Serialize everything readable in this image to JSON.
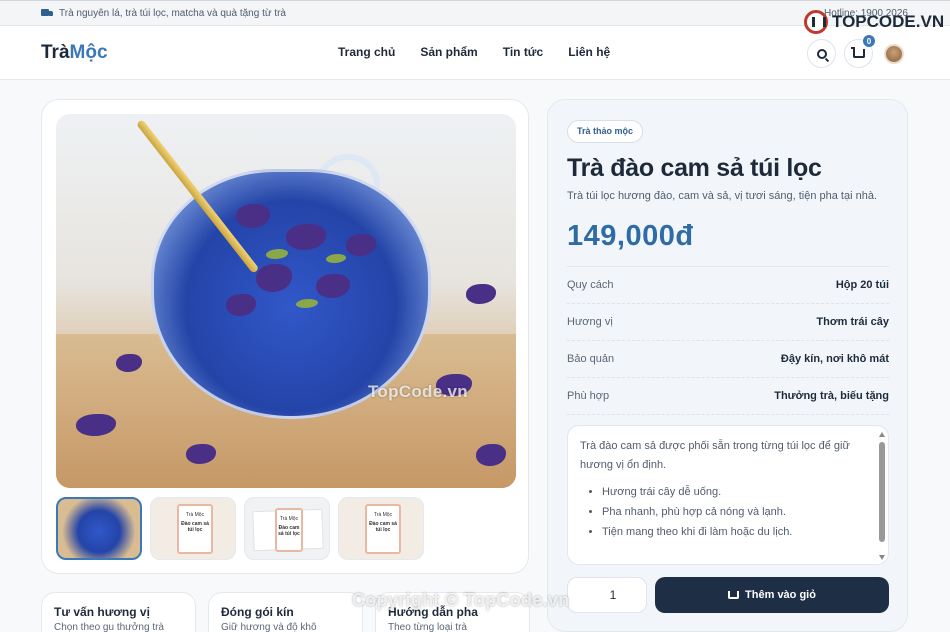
{
  "topbar": {
    "announcement": "Trà nguyên lá, trà túi lọc, matcha và quà tặng từ trà",
    "hotline": "Hotline: 1900 2026"
  },
  "header": {
    "logo_main": "Trà",
    "logo_accent": "Mộc",
    "nav": [
      "Trang chủ",
      "Sản phẩm",
      "Tin tức",
      "Liên hệ"
    ],
    "cart_count": "0"
  },
  "watermarks": {
    "brand": "TOPCODE.VN",
    "center": "TopCode.vn",
    "bottom": "Copyright © TopCode.vn"
  },
  "product": {
    "category": "Trà thảo mộc",
    "title": "Trà đào cam sả túi lọc",
    "subtitle": "Trà túi lọc hương đào, cam và sả, vị tươi sáng, tiện pha tại nhà.",
    "price": "149,000đ",
    "specs": [
      {
        "label": "Quy cách",
        "value": "Hộp 20 túi"
      },
      {
        "label": "Hương vị",
        "value": "Thơm trái cây"
      },
      {
        "label": "Bảo quản",
        "value": "Đậy kín, nơi khô mát"
      },
      {
        "label": "Phù hợp",
        "value": "Thưởng trà, biếu tặng"
      }
    ],
    "description": "Trà đào cam sả được phối sẵn trong từng túi lọc để giữ hương vị ổn định.",
    "bullets": [
      "Hương trái cây dễ uống.",
      "Pha nhanh, phù hợp cả nóng và lạnh.",
      "Tiện mang theo khi đi làm hoặc du lịch."
    ],
    "quantity": "1",
    "add_to_cart": "Thêm vào giỏ"
  },
  "thumbnails": {
    "card_brand": "Trà Mộc",
    "card_title": "Đào cam sả túi lọc"
  },
  "features": [
    {
      "title": "Tư vấn hương vị",
      "text": "Chọn theo gu thưởng trà"
    },
    {
      "title": "Đóng gói kín",
      "text": "Giữ hương và độ khô"
    },
    {
      "title": "Hướng dẫn pha",
      "text": "Theo từng loại trà"
    }
  ],
  "colors": {
    "accent": "#3a78b8",
    "dark_button": "#1e2f45",
    "price": "#2f6ca6"
  }
}
